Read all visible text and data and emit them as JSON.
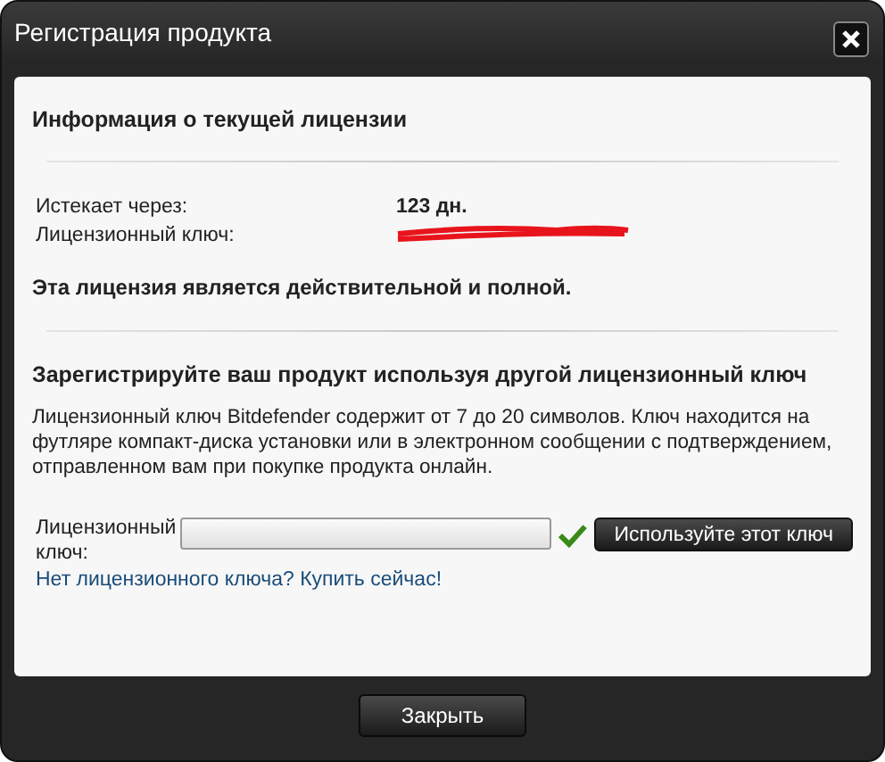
{
  "window": {
    "title": "Регистрация продукта"
  },
  "current_license": {
    "heading": "Информация о текущей лицензии",
    "rows": [
      {
        "kind": "value",
        "label": "Истекает через:",
        "value": "123 дн."
      },
      {
        "kind": "redacted",
        "label": "Лицензионный ключ:"
      }
    ],
    "status": "Эта лицензия является действительной и полной."
  },
  "register": {
    "heading": "Зарегистрируйте ваш продукт используя другой лицензионный ключ",
    "description": "Лицензионный ключ Bitdefender содержит от 7 до 20 символов. Ключ находится на футляре компакт-диска установки или в электронном сообщении с подтверждением, отправленном вам при покупке продукта онлайн.",
    "field_label": "Лицензионный ключ:",
    "valid": true,
    "button": "Используйте этот ключ",
    "buy_link": "Нет лицензионного ключа? Купить сейчас!"
  },
  "footer_button": "Закрыть"
}
